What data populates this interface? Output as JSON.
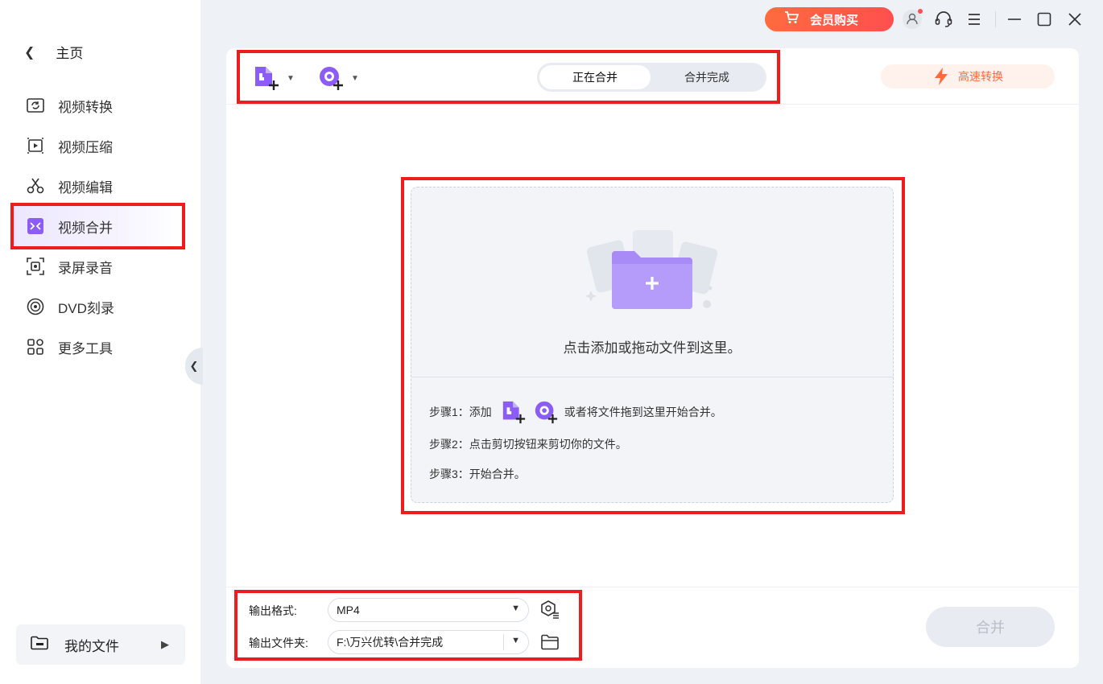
{
  "sidebar": {
    "home_label": "主页",
    "items": [
      {
        "label": "视频转换",
        "icon": "video-convert-icon"
      },
      {
        "label": "视频压缩",
        "icon": "video-compress-icon"
      },
      {
        "label": "视频编辑",
        "icon": "scissors-icon"
      },
      {
        "label": "视频合并",
        "icon": "video-merge-icon",
        "active": true
      },
      {
        "label": "录屏录音",
        "icon": "screen-record-icon"
      },
      {
        "label": "DVD刻录",
        "icon": "disc-icon"
      },
      {
        "label": "更多工具",
        "icon": "grid-icon"
      }
    ],
    "my_files_label": "我的文件"
  },
  "titlebar": {
    "vip_label": "会员购买"
  },
  "toolbar": {
    "tabs": [
      "正在合并",
      "合并完成"
    ],
    "fast_convert_label": "高速转换"
  },
  "dropzone": {
    "hint": "点击添加或拖动文件到这里。",
    "step1_prefix": "步骤1：添加",
    "step1_suffix": "或者将文件拖到这里开始合并。",
    "step2": "步骤2：点击剪切按钮来剪切你的文件。",
    "step3": "步骤3：开始合并。"
  },
  "output": {
    "format_label": "输出格式:",
    "format_value": "MP4",
    "folder_label": "输出文件夹:",
    "folder_value": "F:\\万兴优转\\合并完成"
  },
  "merge_button_label": "合并",
  "colors": {
    "accent": "#8b5cf6",
    "highlight": "#ee1c1c",
    "vip": "#ff5a45",
    "fast": "#ff6a3d"
  }
}
